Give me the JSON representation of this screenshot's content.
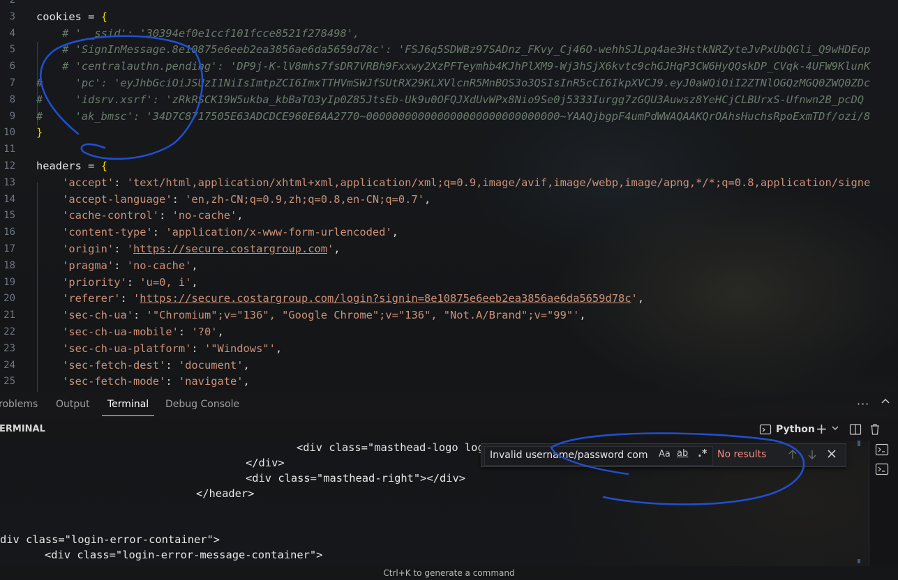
{
  "editor": {
    "lines": [
      {
        "n": "2",
        "text": ""
      },
      {
        "n": "3",
        "segs": [
          [
            "c-var",
            "cookies"
          ],
          [
            "c-op",
            " = "
          ],
          [
            "c-brace",
            "{"
          ]
        ]
      },
      {
        "n": "4",
        "segs": [
          [
            "c-com",
            "    # '__ssid': '30394ef0e1ccf101fcce8521f278498',"
          ]
        ]
      },
      {
        "n": "5",
        "segs": [
          [
            "c-com",
            "    # 'SignInMessage.8e10875e6eeb2ea3856ae6da5659d78c': 'FSJ6q5SDWBz97SADnz_FKvy_Cj46O-wehhSJLpq4ae3HstkNRZyteJvPxUbQGli_Q9wHDEop"
          ]
        ]
      },
      {
        "n": "6",
        "segs": [
          [
            "c-com",
            "    # 'centralauthn.pending': 'DP9j-K-lV8mhs7fsDR7VRBh9Fxxwy2XzPFTeymhb4KJhPlXM9-Wj3hSjX6kvtc9chGJHqP3CW6HyQQskDP_CVqk-4UFW9KlunK"
          ]
        ]
      },
      {
        "n": "7",
        "segs": [
          [
            "c-com",
            "#     'pc': 'eyJhbGciOiJSUzI1NiIsImtpZCI6ImxTTHVmSWJfSUtRX29KLXVlcnR5MnBOS3o3QSIsInR5cCI6IkpXVCJ9.eyJ0aWQiOiI2ZTNlOGQzMGQ0ZWQ0ZDc"
          ]
        ]
      },
      {
        "n": "8",
        "segs": [
          [
            "c-com",
            "#     'idsrv.xsrf': 'zRkRSCK19W5ukba_kbBaTO3yIp0Z85JtsEb-Uk9u0OFQJXdUvWPx8Nio9Se0j5333Iurgg7zGQU3Auwsz8YeHCjCLBUrxS-Ufnwn2B_pcDQ"
          ]
        ]
      },
      {
        "n": "9",
        "segs": [
          [
            "c-com",
            "#     'ak_bmsc': '34D7C8717505E63ADCDCE960E6AA2770~000000000000000000000000000000~YAAQjbgpF4umPdWWAQAAKQrOAhsHuchsRpoExmTDf/ozi/8"
          ]
        ]
      },
      {
        "n": "10",
        "segs": [
          [
            "c-brace",
            "}"
          ]
        ]
      },
      {
        "n": "11",
        "text": ""
      },
      {
        "n": "12",
        "segs": [
          [
            "c-var",
            "headers"
          ],
          [
            "c-op",
            " = "
          ],
          [
            "c-brace",
            "{"
          ]
        ]
      },
      {
        "n": "13",
        "segs": [
          [
            "c-key",
            "    'accept'"
          ],
          [
            "c-op",
            ": "
          ],
          [
            "c-str",
            "'text/html,application/xhtml+xml,application/xml;q=0.9,image/avif,image/webp,image/apng,*/*;q=0.8,application/signe"
          ]
        ]
      },
      {
        "n": "14",
        "segs": [
          [
            "c-key",
            "    'accept-language'"
          ],
          [
            "c-op",
            ": "
          ],
          [
            "c-str",
            "'en,zh-CN;q=0.9,zh;q=0.8,en-CN;q=0.7'"
          ],
          [
            "c-op",
            ","
          ]
        ]
      },
      {
        "n": "15",
        "segs": [
          [
            "c-key",
            "    'cache-control'"
          ],
          [
            "c-op",
            ": "
          ],
          [
            "c-str",
            "'no-cache'"
          ],
          [
            "c-op",
            ","
          ]
        ]
      },
      {
        "n": "16",
        "segs": [
          [
            "c-key",
            "    'content-type'"
          ],
          [
            "c-op",
            ": "
          ],
          [
            "c-str",
            "'application/x-www-form-urlencoded'"
          ],
          [
            "c-op",
            ","
          ]
        ]
      },
      {
        "n": "17",
        "segs": [
          [
            "c-key",
            "    'origin'"
          ],
          [
            "c-op",
            ": "
          ],
          [
            "c-str",
            "'"
          ],
          [
            "c-url",
            "https://secure.costargroup.com"
          ],
          [
            "c-str",
            "'"
          ],
          [
            "c-op",
            ","
          ]
        ]
      },
      {
        "n": "18",
        "segs": [
          [
            "c-key",
            "    'pragma'"
          ],
          [
            "c-op",
            ": "
          ],
          [
            "c-str",
            "'no-cache'"
          ],
          [
            "c-op",
            ","
          ]
        ]
      },
      {
        "n": "19",
        "segs": [
          [
            "c-key",
            "    'priority'"
          ],
          [
            "c-op",
            ": "
          ],
          [
            "c-str",
            "'u=0, i'"
          ],
          [
            "c-op",
            ","
          ]
        ]
      },
      {
        "n": "20",
        "segs": [
          [
            "c-key",
            "    'referer'"
          ],
          [
            "c-op",
            ": "
          ],
          [
            "c-str",
            "'"
          ],
          [
            "c-url",
            "https://secure.costargroup.com/login?signin=8e10875e6eeb2ea3856ae6da5659d78c"
          ],
          [
            "c-str",
            "'"
          ],
          [
            "c-op",
            ","
          ]
        ]
      },
      {
        "n": "21",
        "segs": [
          [
            "c-key",
            "    'sec-ch-ua'"
          ],
          [
            "c-op",
            ": "
          ],
          [
            "c-str",
            "'\"Chromium\";v=\"136\", \"Google Chrome\";v=\"136\", \"Not.A/Brand\";v=\"99\"'"
          ],
          [
            "c-op",
            ","
          ]
        ]
      },
      {
        "n": "22",
        "segs": [
          [
            "c-key",
            "    'sec-ch-ua-mobile'"
          ],
          [
            "c-op",
            ": "
          ],
          [
            "c-str",
            "'?0'"
          ],
          [
            "c-op",
            ","
          ]
        ]
      },
      {
        "n": "23",
        "segs": [
          [
            "c-key",
            "    'sec-ch-ua-platform'"
          ],
          [
            "c-op",
            ": "
          ],
          [
            "c-str",
            "'\"Windows\"'"
          ],
          [
            "c-op",
            ","
          ]
        ]
      },
      {
        "n": "24",
        "segs": [
          [
            "c-key",
            "    'sec-fetch-dest'"
          ],
          [
            "c-op",
            ": "
          ],
          [
            "c-str",
            "'document'"
          ],
          [
            "c-op",
            ","
          ]
        ]
      },
      {
        "n": "25",
        "segs": [
          [
            "c-key",
            "    'sec-fetch-mode'"
          ],
          [
            "c-op",
            ": "
          ],
          [
            "c-str",
            "'navigate'"
          ],
          [
            "c-op",
            ","
          ]
        ]
      }
    ]
  },
  "panel": {
    "tabs": [
      {
        "label": "roblems",
        "active": false
      },
      {
        "label": "Output",
        "active": false
      },
      {
        "label": "Terminal",
        "active": true
      },
      {
        "label": "Debug Console",
        "active": false
      }
    ],
    "more_icon": "ellipsis-icon",
    "maximize_icon": "chevron-up-icon"
  },
  "terminal_header": {
    "title": "ERMINAL",
    "profile": "Python"
  },
  "terminal": {
    "lines": [
      {
        "indent": 425,
        "text": "<div class=\"masthead-logo logo"
      },
      {
        "indent": 352,
        "text": "</div>"
      },
      {
        "indent": 352,
        "text": "<div class=\"masthead-right\"></div>"
      },
      {
        "indent": 281,
        "text": "</header>"
      },
      {
        "indent": 0,
        "text": ""
      },
      {
        "indent": 0,
        "text": ""
      },
      {
        "indent": 0,
        "text": "div class=\"login-error-container\">"
      },
      {
        "indent": 64,
        "text": "<div class=\"login-error-message-container\">"
      }
    ]
  },
  "find_widget": {
    "query": "Invalid username/password com",
    "match_case": "Aa",
    "whole_word": "ab",
    "regex": ".*",
    "result": "No results"
  },
  "status_bar": {
    "hint": "Ctrl+K to generate a command"
  },
  "colors": {
    "annotation": "#1f4fd1",
    "no_results": "#f28b82"
  }
}
